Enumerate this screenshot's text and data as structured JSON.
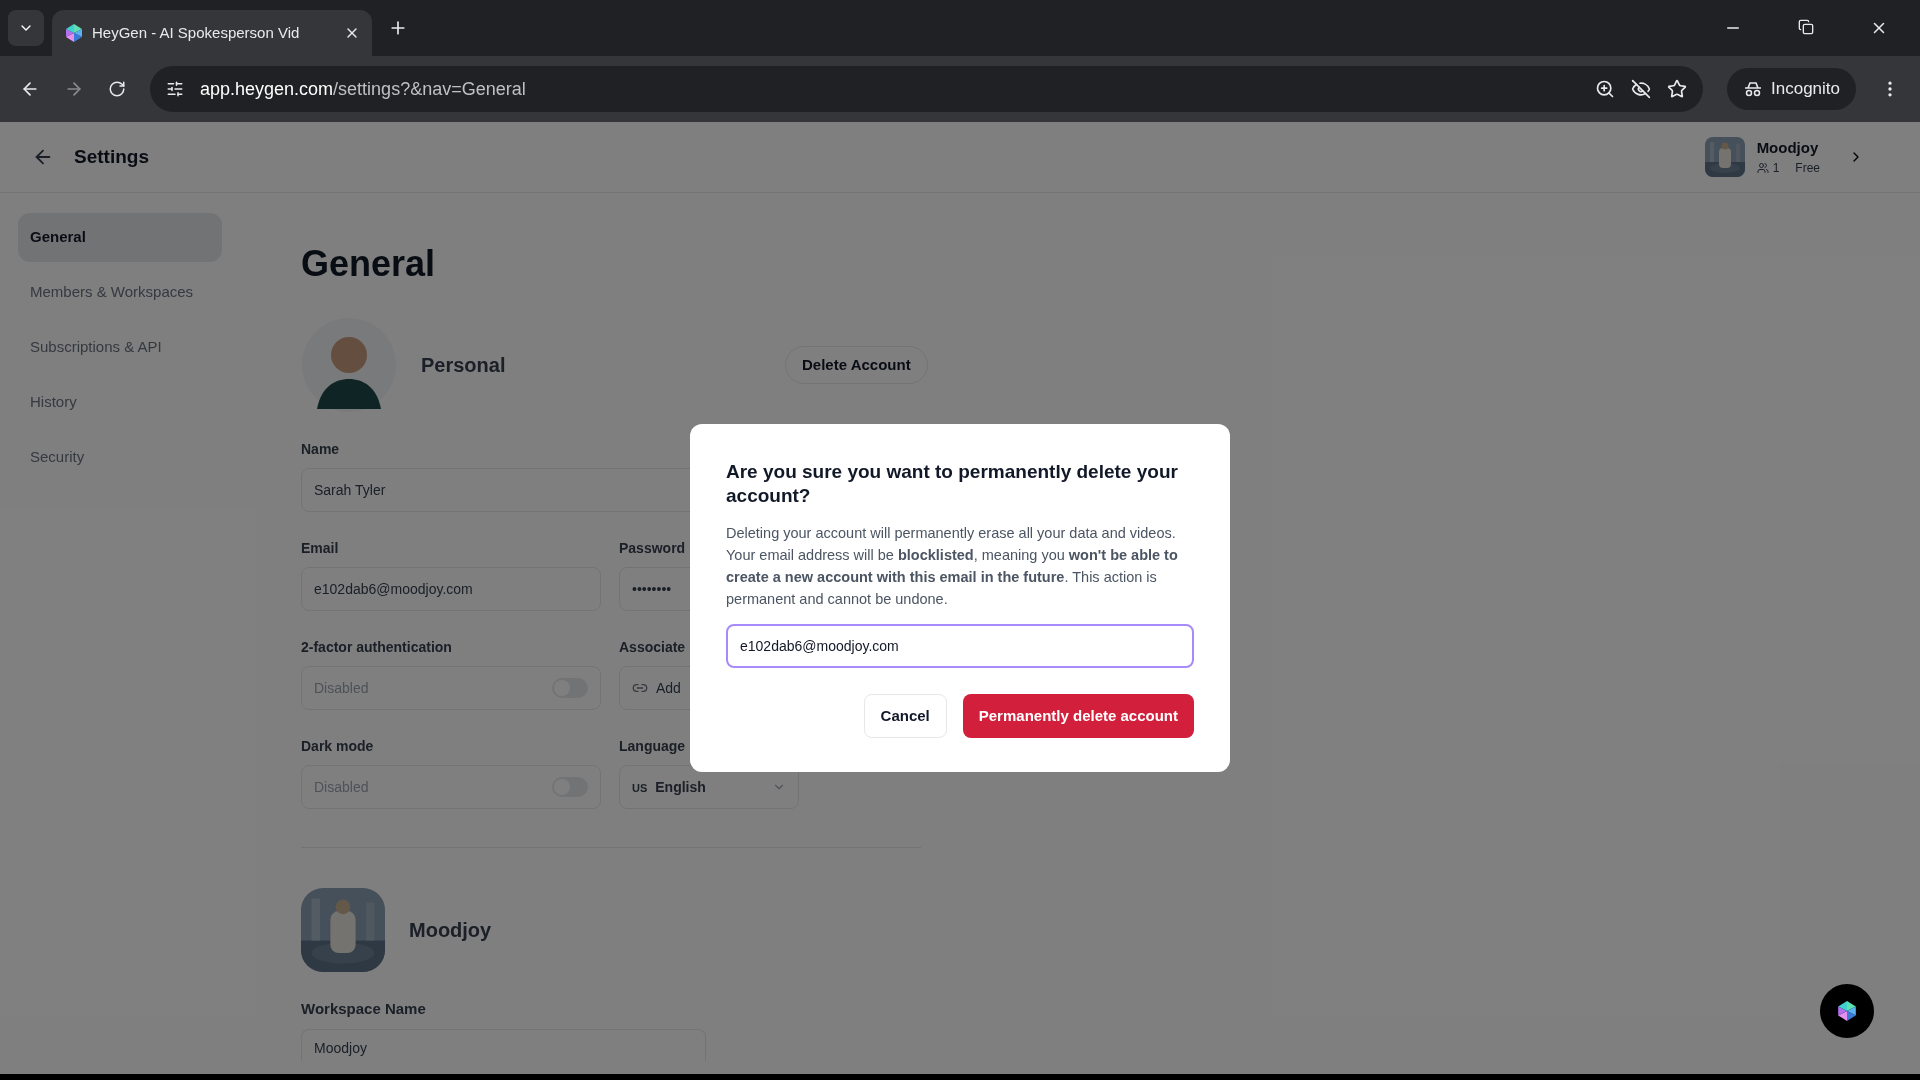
{
  "browser": {
    "tabs": [
      {
        "title": "HeyGen - AI Spokesperson Vid",
        "selected": true
      }
    ],
    "url_host": "app.heygen.com",
    "url_path": "/settings?&nav=General",
    "incognito": "Incognito"
  },
  "header": {
    "title": "Settings",
    "account": {
      "name": "Moodjoy",
      "members": "1",
      "plan": "Free"
    }
  },
  "sidebar": {
    "items": [
      {
        "label": "General",
        "selected": true
      },
      {
        "label": "Members & Workspaces",
        "selected": false
      },
      {
        "label": "Subscriptions & API",
        "selected": false
      },
      {
        "label": "History",
        "selected": false
      },
      {
        "label": "Security",
        "selected": false
      }
    ]
  },
  "general": {
    "heading": "General",
    "personal": {
      "title": "Personal",
      "delete_button": "Delete Account"
    },
    "rows": [
      [
        {
          "kind": "text",
          "label": "Name",
          "value": "Sarah Tyler",
          "wide": true
        }
      ],
      [
        {
          "kind": "text",
          "label": "Email",
          "value": "e102dab6@moodjoy.com"
        },
        {
          "kind": "text",
          "label": "Password",
          "value": "••••••••"
        }
      ],
      [
        {
          "kind": "toggle",
          "label": "2-factor authentication",
          "value": "Disabled",
          "on": false
        },
        {
          "kind": "link",
          "label": "Associate",
          "value": "Add"
        }
      ],
      [
        {
          "kind": "toggle",
          "label": "Dark mode",
          "value": "Disabled",
          "on": false
        },
        {
          "kind": "select",
          "label": "Language",
          "flag": "US",
          "value": "English"
        }
      ]
    ]
  },
  "workspace": {
    "title": "Moodjoy",
    "label": "Workspace Name",
    "value": "Moodjoy"
  },
  "dialog": {
    "title": "Are you sure you want to permanently delete your account?",
    "body": "Deleting your account will permanently erase all your data and videos. Your email address will be **blocklisted**, meaning you **won't be able to create a new account with this email in the future**. This action is permanent and cannot be undone.",
    "input": "e102dab6@moodjoy.com",
    "cancel": "Cancel",
    "confirm": "Permanently delete account"
  }
}
